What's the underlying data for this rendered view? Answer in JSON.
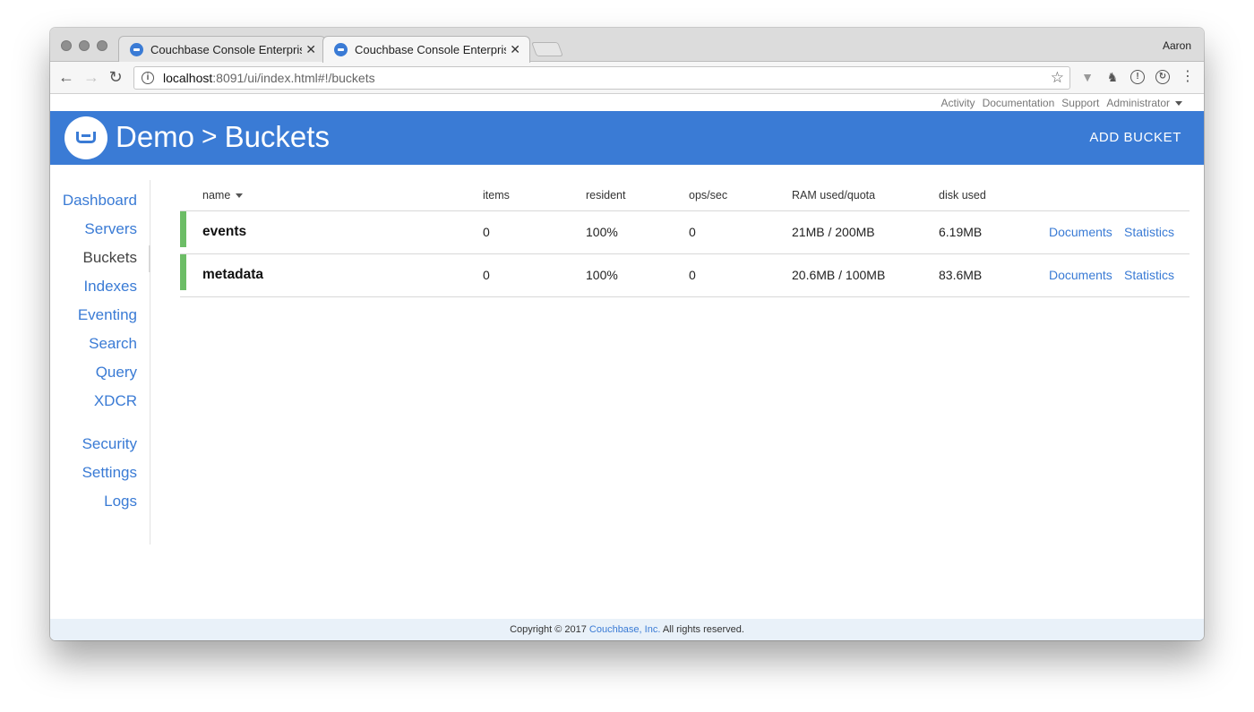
{
  "browser": {
    "tabs": [
      {
        "title": "Couchbase Console Enterprise"
      },
      {
        "title": "Couchbase Console Enterprise"
      }
    ],
    "tab_close": "✕",
    "profile": "Aaron",
    "url_host": "localhost",
    "url_path": ":8091/ui/index.html#!/buckets",
    "icons": {
      "back": "back-arrow-icon",
      "forward": "forward-arrow-icon",
      "reload": "reload-icon",
      "info": "info-icon",
      "star": "bookmark-star-icon",
      "ext1": "vue-devtools-icon",
      "ext2": "evernote-icon",
      "ext3": "info-extension-icon",
      "ext4": "sync-extension-icon",
      "menu": "kebab-menu-icon"
    }
  },
  "utilnav": {
    "items": [
      "Activity",
      "Documentation",
      "Support",
      "Administrator"
    ]
  },
  "header": {
    "cluster": "Demo",
    "separator": ">",
    "page": "Buckets",
    "add_button": "ADD BUCKET",
    "brand_color": "#3a7bd5"
  },
  "sidebar": {
    "items": [
      "Dashboard",
      "Servers",
      "Buckets",
      "Indexes",
      "Eventing",
      "Search",
      "Query",
      "XDCR",
      "Security",
      "Settings",
      "Logs"
    ],
    "active": "Buckets"
  },
  "table": {
    "columns": [
      "name",
      "items",
      "resident",
      "ops/sec",
      "RAM used/quota",
      "disk used"
    ],
    "rows": [
      {
        "name": "events",
        "items": "0",
        "resident": "100%",
        "ops": "0",
        "ram": "21MB / 200MB",
        "disk": "6.19MB",
        "link1": "Documents",
        "link2": "Statistics"
      },
      {
        "name": "metadata",
        "items": "0",
        "resident": "100%",
        "ops": "0",
        "ram": "20.6MB / 100MB",
        "disk": "83.6MB",
        "link1": "Documents",
        "link2": "Statistics"
      }
    ],
    "status_color": "#6cbd66"
  },
  "footer": {
    "prefix": "Copyright © 2017 ",
    "link": "Couchbase, Inc.",
    "suffix": " All rights reserved."
  }
}
